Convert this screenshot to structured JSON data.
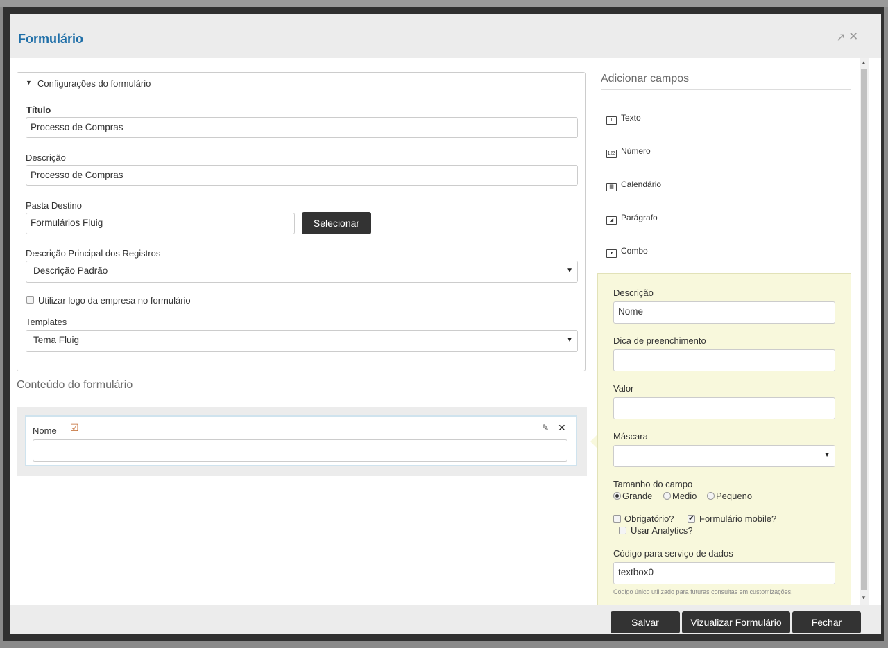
{
  "dialog": {
    "title": "Formulário",
    "popout_icon": "popout-icon",
    "close_icon": "close-icon"
  },
  "config": {
    "section_label": "Configurações do formulário",
    "titulo_label": "Título",
    "titulo_value": "Processo de Compras",
    "descricao_label": "Descrição",
    "descricao_value": "Processo de Compras",
    "pasta_label": "Pasta Destino",
    "pasta_value": "Formulários Fluig",
    "selecionar_label": "Selecionar",
    "desc_principal_label": "Descrição Principal dos Registros",
    "desc_principal_value": "Descrição Padrão",
    "logo_label": "Utilizar logo da empresa no formulário",
    "templates_label": "Templates",
    "templates_value": "Tema Fluig"
  },
  "content": {
    "section_label": "Conteúdo do formulário",
    "field_label": "Nome"
  },
  "add_fields": {
    "title": "Adicionar campos",
    "items": [
      {
        "label": "Texto",
        "icon": "text-field-icon"
      },
      {
        "label": "Número",
        "icon": "number-field-icon"
      },
      {
        "label": "Calendário",
        "icon": "calendar-icon"
      },
      {
        "label": "Parágrafo",
        "icon": "paragraph-icon"
      },
      {
        "label": "Combo",
        "icon": "combo-icon"
      }
    ]
  },
  "properties": {
    "descricao_label": "Descrição",
    "descricao_value": "Nome",
    "dica_label": "Dica de preenchimento",
    "dica_value": "",
    "valor_label": "Valor",
    "valor_value": "",
    "mascara_label": "Máscara",
    "mascara_value": "",
    "tamanho_label": "Tamanho do campo",
    "size_grande": "Grande",
    "size_medio": "Medio",
    "size_pequeno": "Pequeno",
    "obrigatorio_label": "Obrigatório?",
    "mobile_label": "Formulário mobile?",
    "analytics_label": "Usar Analytics?",
    "codigo_label": "Código para serviço de dados",
    "codigo_value": "textbox0",
    "codigo_hint": "Código único utilizado para futuras consultas em customizações."
  },
  "footer": {
    "salvar": "Salvar",
    "visualizar": "Vizualizar Formulário",
    "fechar": "Fechar"
  }
}
